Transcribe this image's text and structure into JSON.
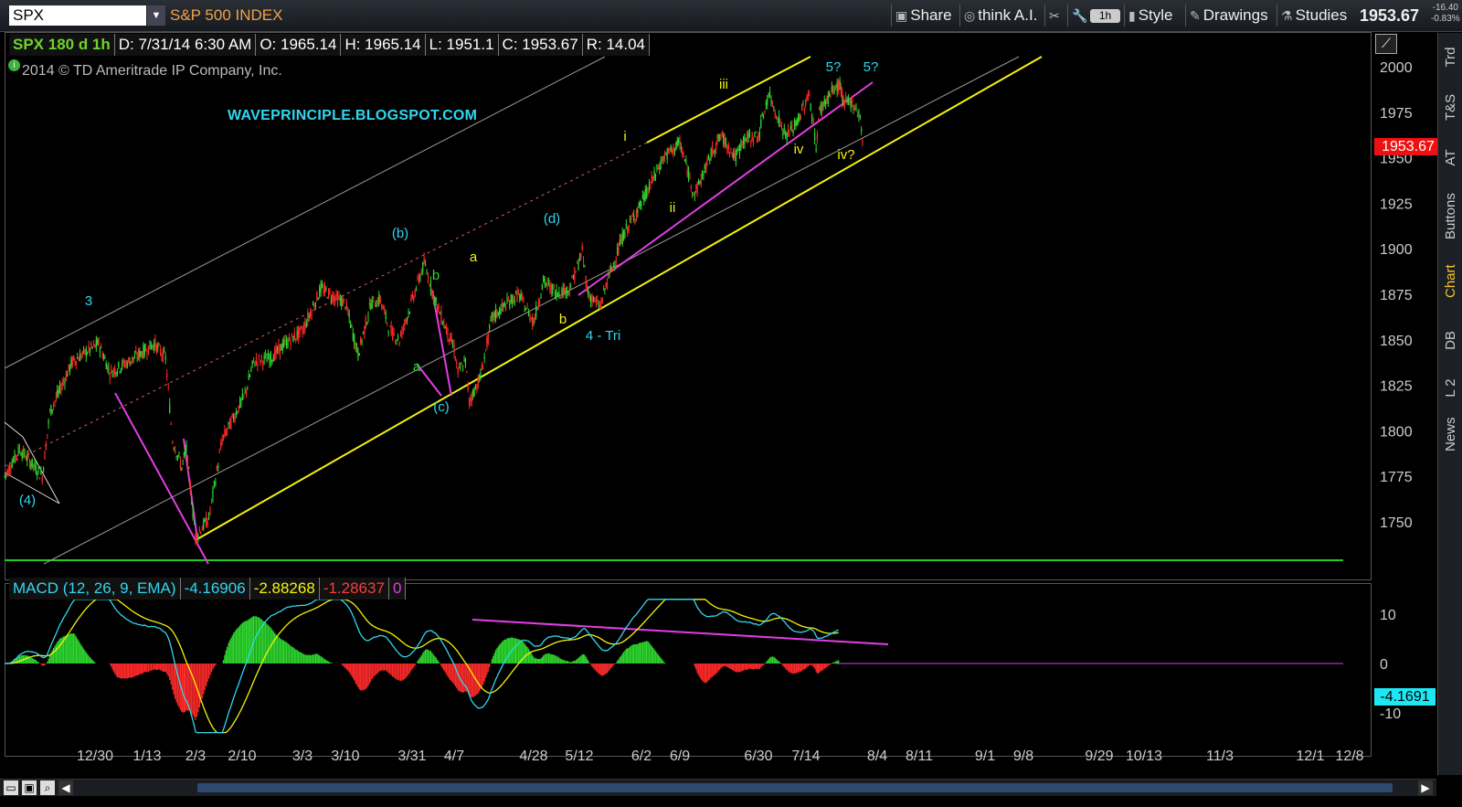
{
  "toolbar": {
    "symbol": "SPX",
    "description": "S&P 500 INDEX",
    "share": "Share",
    "think_ai": "think A.I.",
    "timeframe": "1h",
    "style": "Style",
    "drawings": "Drawings",
    "studies": "Studies",
    "last_price": "1953.67",
    "change": "-16.40",
    "change_pct": "-0.83%"
  },
  "info": {
    "symbol": "SPX 180 d 1h",
    "date": "D: 7/31/14 6:30 AM",
    "open": "O: 1965.14",
    "high": "H: 1965.14",
    "low": "L: 1951.1",
    "close": "C: 1953.67",
    "range": "R: 14.04",
    "copyright": "2014 © TD Ameritrade IP Company, Inc.",
    "site": "WAVEPRINCIPLE.BLOGSPOT.COM"
  },
  "macd": {
    "label": "MACD (12, 26, 9, EMA)",
    "value": "-4.16906",
    "avg": "-2.88268",
    "diff": "-1.28637",
    "zero": "0",
    "tag": "-4.1691"
  },
  "sidebar": [
    "Trd",
    "T&S",
    "AT",
    "Buttons",
    "Chart",
    "DB",
    "L 2",
    "News"
  ],
  "colors": {
    "up": "#2fd82f",
    "down": "#ff2a2a",
    "yellow": "#f4f40a",
    "magenta": "#e23ee2",
    "cyan": "#2fd8f0",
    "grid": "#888888"
  },
  "chart_data": {
    "type": "candlestick",
    "price_axis": [
      1750,
      1775,
      1800,
      1825,
      1850,
      1875,
      1900,
      1925,
      1950,
      1975,
      2000
    ],
    "price_range": [
      1729,
      2006
    ],
    "last_price_tag": "1953.67",
    "date_labels": [
      "12/30",
      "1/13",
      "2/3",
      "2/10",
      "3/3",
      "3/10",
      "3/31",
      "4/7",
      "4/28",
      "5/12",
      "6/2",
      "6/9",
      "6/30",
      "7/14",
      "8/4",
      "8/11",
      "9/1",
      "9/8",
      "9/29",
      "10/13",
      "11/3",
      "12/1",
      "12/8"
    ],
    "price_path": [
      {
        "d": "12/18",
        "p": 1775
      },
      {
        "d": "12/20",
        "p": 1790
      },
      {
        "d": "12/23",
        "p": 1775
      },
      {
        "d": "12/24",
        "p": 1810
      },
      {
        "d": "12/27",
        "p": 1838
      },
      {
        "d": "12/31",
        "p": 1848
      },
      {
        "d": "1/3",
        "p": 1832
      },
      {
        "d": "1/8",
        "p": 1838
      },
      {
        "d": "1/13",
        "p": 1845
      },
      {
        "d": "1/16",
        "p": 1848
      },
      {
        "d": "1/21",
        "p": 1840
      },
      {
        "d": "1/24",
        "p": 1795
      },
      {
        "d": "1/28",
        "p": 1780
      },
      {
        "d": "1/30",
        "p": 1790
      },
      {
        "d": "2/3",
        "p": 1742
      },
      {
        "d": "2/5",
        "p": 1752
      },
      {
        "d": "2/7",
        "p": 1795
      },
      {
        "d": "2/11",
        "p": 1820
      },
      {
        "d": "2/14",
        "p": 1838
      },
      {
        "d": "2/20",
        "p": 1840
      },
      {
        "d": "2/25",
        "p": 1848
      },
      {
        "d": "3/3",
        "p": 1855
      },
      {
        "d": "3/6",
        "p": 1878
      },
      {
        "d": "3/10",
        "p": 1870
      },
      {
        "d": "3/14",
        "p": 1842
      },
      {
        "d": "3/18",
        "p": 1870
      },
      {
        "d": "3/21",
        "p": 1872
      },
      {
        "d": "3/24",
        "p": 1855
      },
      {
        "d": "3/27",
        "p": 1850
      },
      {
        "d": "4/2",
        "p": 1892
      },
      {
        "d": "4/4",
        "p": 1870
      },
      {
        "d": "4/7",
        "p": 1845
      },
      {
        "d": "4/8",
        "p": 1832
      },
      {
        "d": "4/10",
        "p": 1838
      },
      {
        "d": "4/11",
        "p": 1816
      },
      {
        "d": "4/14",
        "p": 1830
      },
      {
        "d": "4/17",
        "p": 1862
      },
      {
        "d": "4/21",
        "p": 1870
      },
      {
        "d": "4/24",
        "p": 1875
      },
      {
        "d": "4/28",
        "p": 1860
      },
      {
        "d": "5/1",
        "p": 1882
      },
      {
        "d": "5/5",
        "p": 1876
      },
      {
        "d": "5/9",
        "p": 1878
      },
      {
        "d": "5/13",
        "p": 1898
      },
      {
        "d": "5/15",
        "p": 1875
      },
      {
        "d": "5/19",
        "p": 1868
      },
      {
        "d": "5/21",
        "p": 1880
      },
      {
        "d": "5/27",
        "p": 1908
      },
      {
        "d": "6/2",
        "p": 1925
      },
      {
        "d": "6/6",
        "p": 1950
      },
      {
        "d": "6/9",
        "p": 1958
      },
      {
        "d": "6/12",
        "p": 1936
      },
      {
        "d": "6/13",
        "p": 1930
      },
      {
        "d": "6/18",
        "p": 1955
      },
      {
        "d": "6/20",
        "p": 1962
      },
      {
        "d": "6/24",
        "p": 1950
      },
      {
        "d": "6/26",
        "p": 1960
      },
      {
        "d": "6/30",
        "p": 1962
      },
      {
        "d": "7/3",
        "p": 1985
      },
      {
        "d": "7/8",
        "p": 1962
      },
      {
        "d": "7/11",
        "p": 1968
      },
      {
        "d": "7/15",
        "p": 1985
      },
      {
        "d": "7/17",
        "p": 1956
      },
      {
        "d": "7/18",
        "p": 1976
      },
      {
        "d": "7/22",
        "p": 1987
      },
      {
        "d": "7/24",
        "p": 1990
      },
      {
        "d": "7/25",
        "p": 1980
      },
      {
        "d": "7/28",
        "p": 1980
      },
      {
        "d": "7/30",
        "p": 1972
      },
      {
        "d": "7/31",
        "p": 1953
      }
    ],
    "macd_axis": [
      10,
      0,
      -10
    ],
    "macd_range": [
      -15,
      14
    ],
    "wave_labels": [
      {
        "text": "(4)",
        "color": "cyan"
      },
      {
        "text": "3",
        "color": "cyan"
      },
      {
        "text": "(b)",
        "color": "cyan"
      },
      {
        "text": "(c)",
        "color": "cyan"
      },
      {
        "text": "(d)",
        "color": "cyan"
      },
      {
        "text": "4 - Tri",
        "color": "cyan"
      },
      {
        "text": "a",
        "color": "green"
      },
      {
        "text": "b",
        "color": "green"
      },
      {
        "text": "a",
        "color": "yellow"
      },
      {
        "text": "b",
        "color": "yellow"
      },
      {
        "text": "i",
        "color": "yellow"
      },
      {
        "text": "ii",
        "color": "yellow"
      },
      {
        "text": "iii",
        "color": "yellow"
      },
      {
        "text": "iv",
        "color": "yellow"
      },
      {
        "text": "iv?",
        "color": "yellow"
      },
      {
        "text": "5?",
        "color": "cyan"
      },
      {
        "text": "5?",
        "color": "cyan"
      }
    ]
  }
}
